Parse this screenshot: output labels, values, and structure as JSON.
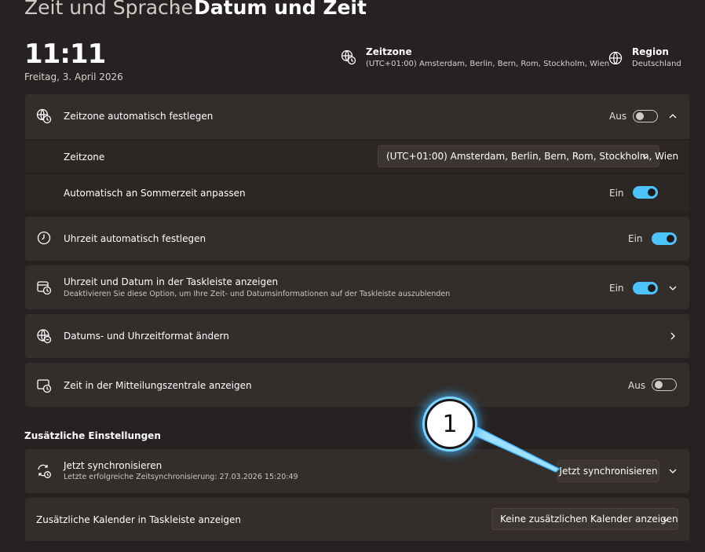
{
  "breadcrumb": {
    "parent": "Zeit und Sprache",
    "separator": "›",
    "current": "Datum und Zeit"
  },
  "clock": {
    "time": "11:11",
    "date": "Freitag, 3. April 2026"
  },
  "header": {
    "timezone": {
      "title": "Zeitzone",
      "value": "(UTC+01:00) Amsterdam, Berlin, Bern, Rom, Stockholm, Wien",
      "icon": "world-clock-icon"
    },
    "region": {
      "title": "Region",
      "value": "Deutschland",
      "icon": "globe-icon"
    }
  },
  "settings": {
    "auto_timezone": {
      "label": "Zeitzone automatisch festlegen",
      "state": "Aus",
      "on": false,
      "expanded": true,
      "icon": "world-clock-icon"
    },
    "timezone_select": {
      "label": "Zeitzone",
      "value": "(UTC+01:00) Amsterdam, Berlin, Bern, Rom, Stockholm, Wien"
    },
    "daylight_saving": {
      "label": "Automatisch an Sommerzeit anpassen",
      "state": "Ein",
      "on": true
    },
    "auto_time": {
      "label": "Uhrzeit automatisch festlegen",
      "state": "Ein",
      "on": true,
      "icon": "clock-icon"
    },
    "taskbar_time": {
      "label": "Uhrzeit und Datum in der Taskleiste anzeigen",
      "description": "Deaktivieren Sie diese Option, um Ihre Zeit- und Datumsinformationen auf der Taskleiste auszublenden",
      "state": "Ein",
      "on": true,
      "icon": "calendar-clock-icon"
    },
    "format": {
      "label": "Datums- und Uhrzeitformat ändern",
      "icon": "globe-format-icon"
    },
    "notification_time": {
      "label": "Zeit in der Mitteilungszentrale anzeigen",
      "state": "Aus",
      "on": false,
      "icon": "notification-clock-icon"
    }
  },
  "additional": {
    "title": "Zusätzliche Einstellungen",
    "sync": {
      "label": "Jetzt synchronisieren",
      "description": "Letzte erfolgreiche Zeitsynchronisierung: 27.03.2026 15:20:49",
      "button": "Jetzt synchronisieren",
      "icon": "sync-clock-icon"
    },
    "calendar": {
      "label": "Zusätzliche Kalender in Taskleiste anzeigen",
      "value": "Keine zusätzlichen Kalender anzeigen"
    }
  },
  "annotation": {
    "number": "1"
  },
  "colors": {
    "background": "#272221",
    "card": "#332d2b",
    "accent": "#4cc2ff",
    "callout_glow": "#3fb5ff"
  }
}
